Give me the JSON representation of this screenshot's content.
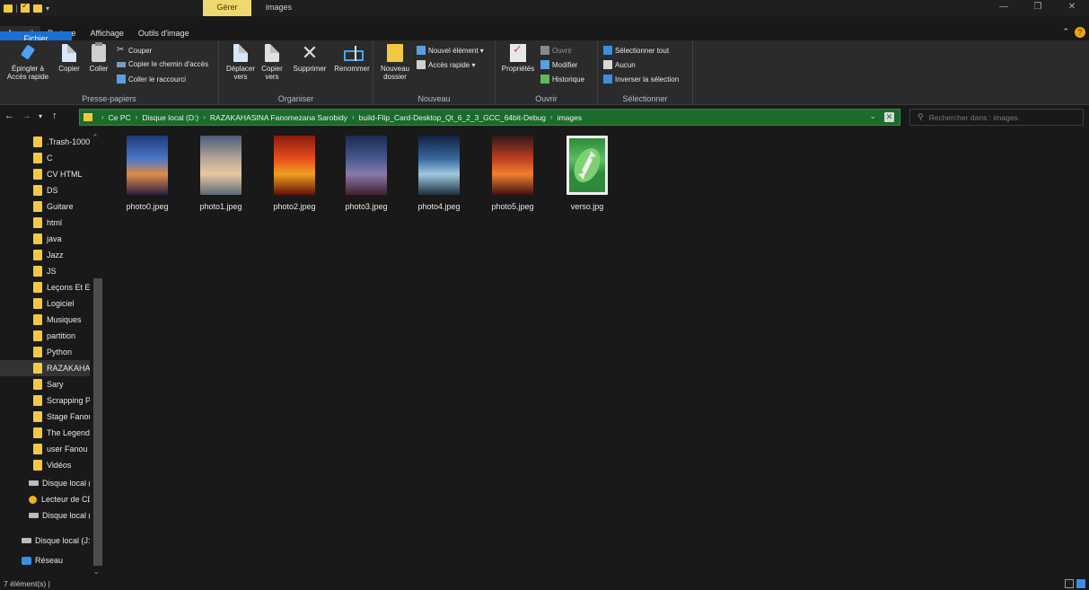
{
  "titlebar": {
    "manage_tab": "Gérer",
    "window_title": "images",
    "minimize": "—",
    "maximize": "❐",
    "close": "✕"
  },
  "tabs": [
    "Fichier",
    "Accueil",
    "Partage",
    "Affichage",
    "Outils d'image"
  ],
  "ribbon": {
    "clipboard": {
      "pin_label_1": "Épingler à",
      "pin_label_2": "Accès rapide",
      "copy": "Copier",
      "paste": "Coller",
      "cut": "Couper",
      "copy_path": "Copier le chemin d'accès",
      "paste_shortcut": "Coller le raccourci",
      "label": "Presse-papiers"
    },
    "organize": {
      "move_1": "Déplacer",
      "move_2": "vers",
      "copy_1": "Copier",
      "copy_2": "vers",
      "delete": "Supprimer",
      "rename": "Renommer",
      "label": "Organiser"
    },
    "new": {
      "new_folder_1": "Nouveau",
      "new_folder_2": "dossier",
      "new_item": "Nouvel élément ▾",
      "easy_access": "Accès rapide ▾",
      "label": "Nouveau"
    },
    "open": {
      "properties": "Propriétés",
      "open": "Ouvrir",
      "edit": "Modifier",
      "history": "Historique",
      "label": "Ouvrir"
    },
    "select": {
      "select_all": "Sélectionner tout",
      "select_none": "Aucun",
      "invert": "Inverser la sélection",
      "label": "Sélectionner"
    }
  },
  "address": {
    "crumbs": [
      "Ce PC",
      "Disque local (D:)",
      "RAZAKAHASINA Fanomezana Sarobidy",
      "build-Flip_Card-Desktop_Qt_6_2_3_GCC_64bit-Debug",
      "images"
    ]
  },
  "search": {
    "placeholder": "Rechercher dans : images"
  },
  "nav": {
    "items": [
      ".Trash-1000",
      "C",
      "CV HTML",
      "DS",
      "Guitare",
      "html",
      "java",
      "Jazz",
      "JS",
      "Leçons Et Ex",
      "Logiciel",
      "Musiques",
      "partition",
      "Python",
      "RAZAKAHAS",
      "Sary",
      "Scrapping P",
      "Stage Fanou",
      "The Legend",
      "user Fanou",
      "Vidéos"
    ],
    "drives": [
      "Disque local (",
      "Lecteur de CD",
      "Disque local (",
      "Disque local (J:)"
    ],
    "network": "Réseau"
  },
  "files": [
    {
      "name": "photo0.jpeg",
      "gradient": [
        "#1d3b7a",
        "#4a78c8",
        "#e08a4a",
        "#2a2040"
      ]
    },
    {
      "name": "photo1.jpeg",
      "gradient": [
        "#4c5c7a",
        "#b8a898",
        "#e8c8a0",
        "#5a6878"
      ]
    },
    {
      "name": "photo2.jpeg",
      "gradient": [
        "#8a1a10",
        "#e8501a",
        "#f0a020",
        "#601008"
      ]
    },
    {
      "name": "photo3.jpeg",
      "gradient": [
        "#1a2a50",
        "#4a5a90",
        "#8a7aa8",
        "#402030"
      ]
    },
    {
      "name": "photo4.jpeg",
      "gradient": [
        "#102040",
        "#3a6aa0",
        "#a0c8e0",
        "#1a3040"
      ]
    },
    {
      "name": "photo5.jpeg",
      "gradient": [
        "#301818",
        "#c04020",
        "#f08030",
        "#401010"
      ]
    },
    {
      "name": "verso.jpg",
      "gradient": [
        "#2e8a3a",
        "#58c060",
        "#2e8a3a",
        "#2e8a3a"
      ]
    }
  ],
  "status": {
    "count": "7 élément(s)  |"
  },
  "colors": {
    "accent": "#1a6fd1",
    "address_bg": "#1b6b2b",
    "manage_tab": "#f0d870",
    "folder": "#f5c842"
  }
}
